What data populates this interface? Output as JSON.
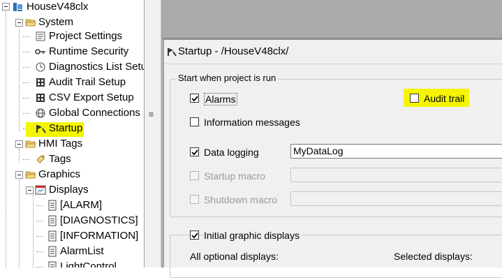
{
  "tree": {
    "root": "HouseV48clx",
    "system": {
      "label": "System",
      "items": [
        {
          "label": "Project Settings",
          "icon": "project-settings-icon"
        },
        {
          "label": "Runtime Security",
          "icon": "key-icon"
        },
        {
          "label": "Diagnostics List Setu",
          "icon": "clock-icon"
        },
        {
          "label": "Audit Trail Setup",
          "icon": "audit-grid-icon"
        },
        {
          "label": "CSV Export Setup",
          "icon": "csv-grid-icon"
        },
        {
          "label": "Global Connections",
          "icon": "globe-icon"
        },
        {
          "label": "Startup",
          "icon": "startup-icon"
        }
      ]
    },
    "hmi_tags": {
      "label": "HMI Tags",
      "items": [
        {
          "label": "Tags",
          "icon": "tag-icon"
        }
      ]
    },
    "graphics": {
      "label": "Graphics"
    },
    "displays": {
      "label": "Displays",
      "items": [
        {
          "label": "[ALARM]"
        },
        {
          "label": "[DIAGNOSTICS]"
        },
        {
          "label": "[INFORMATION]"
        },
        {
          "label": "AlarmList"
        },
        {
          "label": "LightControl"
        }
      ]
    }
  },
  "splitter": {
    "grip": "≡"
  },
  "window": {
    "title": "Startup - /HouseV48clx/",
    "group_start": {
      "legend": "Start when project is run",
      "alarms": {
        "label": "Alarms",
        "checked": true
      },
      "audit_trail": {
        "label": "Audit trail",
        "checked": false
      },
      "info_messages": {
        "label": "Information messages",
        "checked": false
      },
      "data_logging": {
        "label": "Data logging",
        "checked": true,
        "value": "MyDataLog"
      },
      "startup_macro": {
        "label": "Startup macro",
        "checked": false,
        "enabled": false,
        "value": ""
      },
      "shutdown_macro": {
        "label": "Shutdown macro",
        "checked": false,
        "enabled": false,
        "value": ""
      }
    },
    "group_graphics": {
      "legend": "Initial graphic displays",
      "checked": true,
      "all_optional": "All optional displays:",
      "selected": "Selected displays:"
    }
  },
  "colors": {
    "highlight": "#f5f500",
    "workspace": "#ababab",
    "dialog": "#f0f0f0"
  }
}
